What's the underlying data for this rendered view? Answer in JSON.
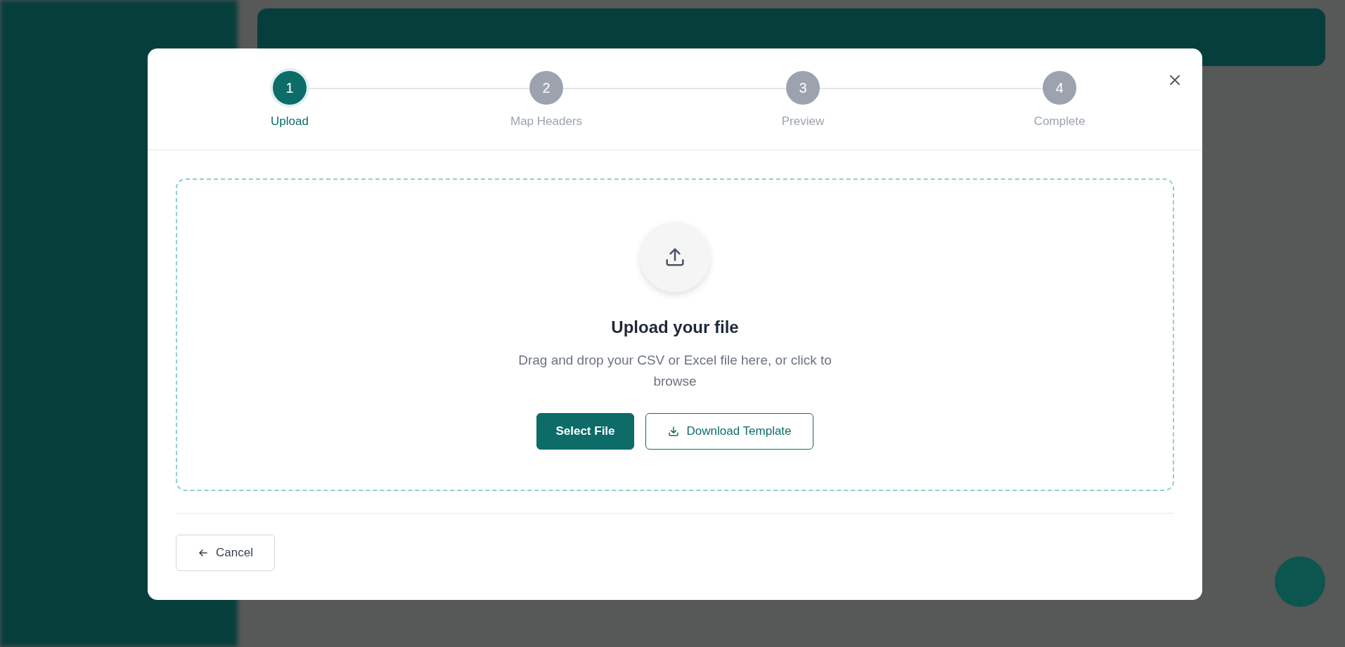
{
  "stepper": {
    "steps": [
      {
        "number": "1",
        "label": "Upload",
        "selected": true
      },
      {
        "number": "2",
        "label": "Map Headers",
        "selected": false
      },
      {
        "number": "3",
        "label": "Preview",
        "selected": false
      },
      {
        "number": "4",
        "label": "Complete",
        "selected": false
      }
    ]
  },
  "dropzone": {
    "title": "Upload your file",
    "description": "Drag and drop your CSV or Excel file here, or click to browse"
  },
  "buttons": [
    {
      "kind": "primary",
      "label": "Select File"
    },
    {
      "kind": "outline",
      "label": "Download Template"
    }
  ],
  "footer": {
    "cancel": "Cancel"
  }
}
